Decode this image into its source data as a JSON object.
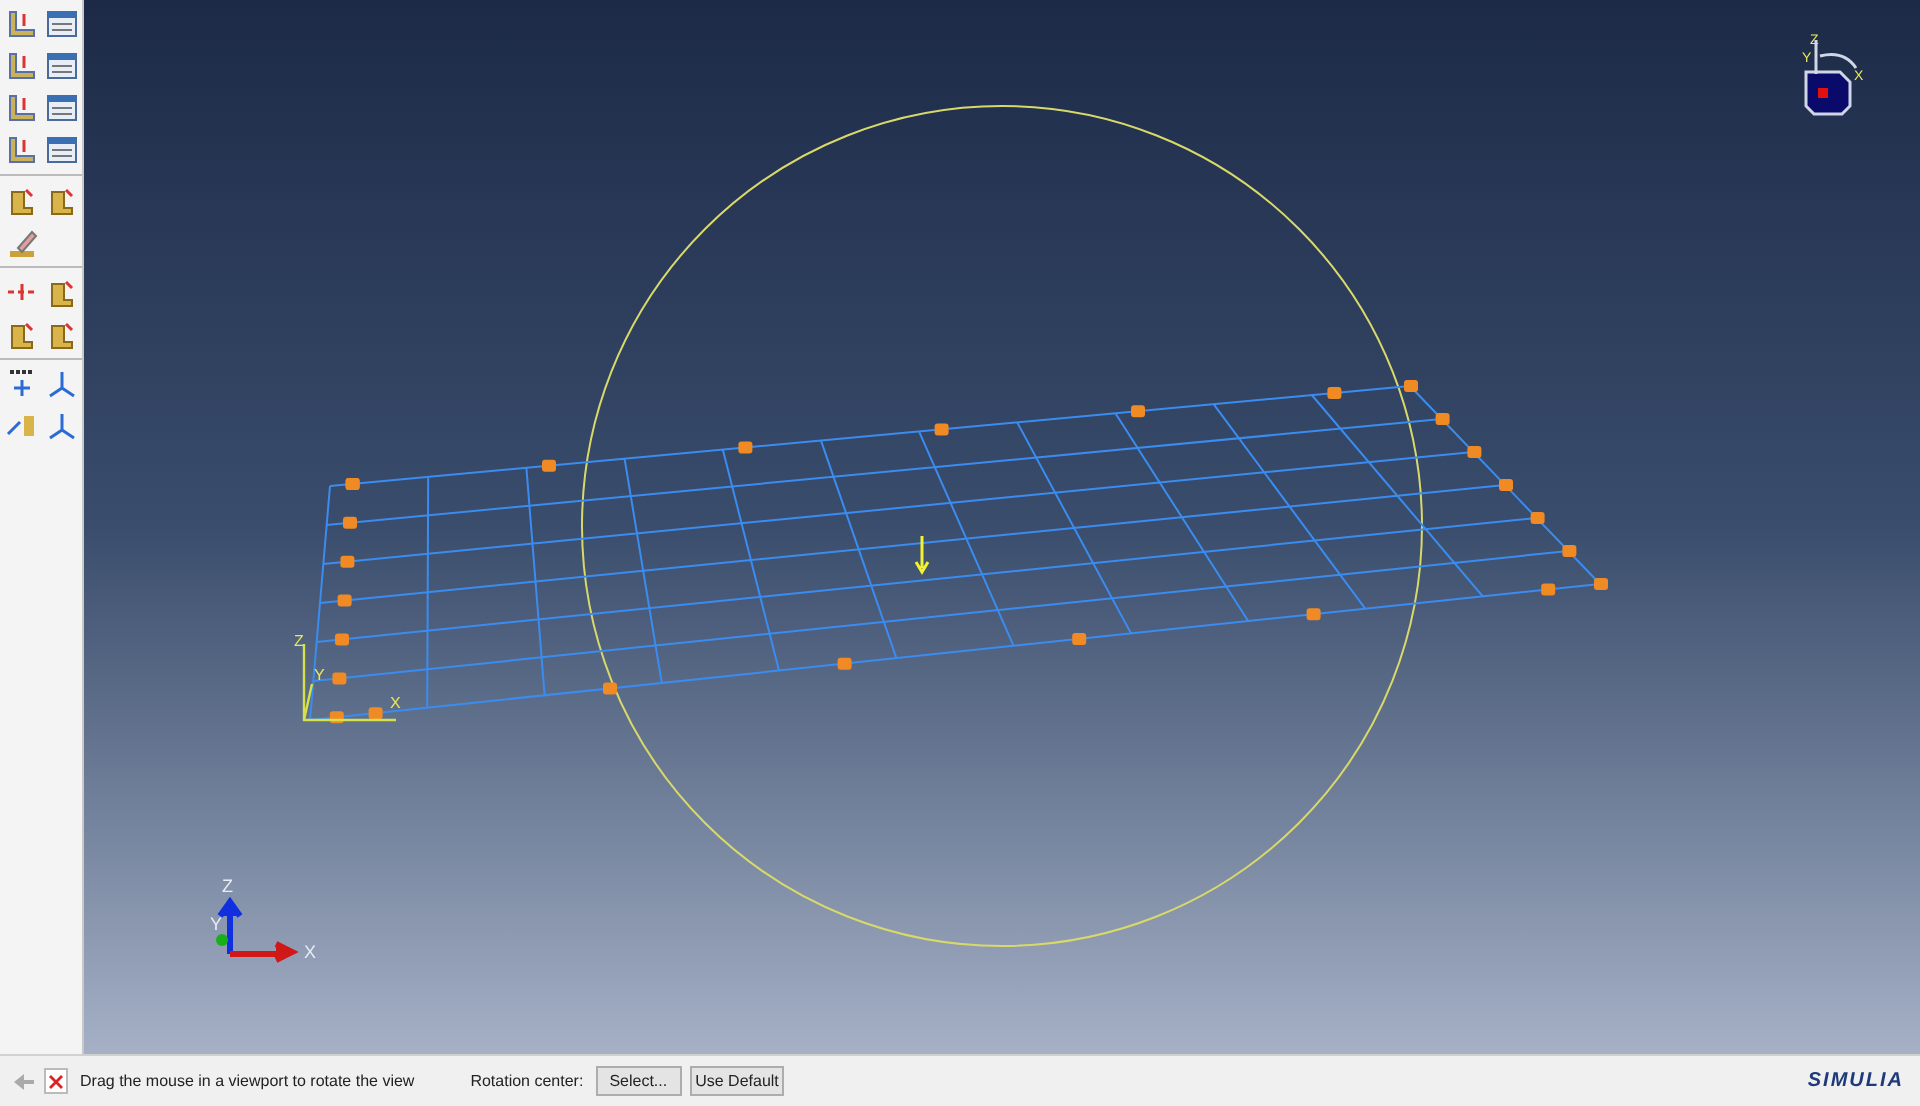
{
  "viewport": {
    "compass_labels": [
      "Z",
      "Y",
      "X"
    ],
    "local_csys_labels": [
      "Z",
      "Y",
      "X"
    ],
    "triad_labels": [
      "Z",
      "Y",
      "X"
    ]
  },
  "status_bar": {
    "back_disabled": true,
    "message": "Drag the mouse in a viewport to rotate the view",
    "rotation_label": "Rotation center:",
    "buttons": [
      "Select...",
      "Use Default"
    ],
    "brand": "SIMULIA"
  }
}
